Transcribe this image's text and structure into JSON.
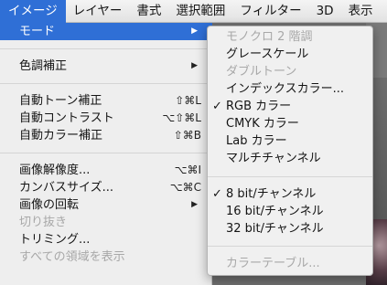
{
  "menubar": {
    "items": [
      "イメージ",
      "レイヤー",
      "書式",
      "選択範囲",
      "フィルター",
      "3D",
      "表示"
    ],
    "active_index": 0
  },
  "image_menu": {
    "items": [
      {
        "label": "モード",
        "shortcut": "",
        "submenu": true,
        "highlighted": true,
        "disabled": false
      },
      {
        "label": "色調補正",
        "shortcut": "",
        "submenu": true,
        "highlighted": false,
        "disabled": false
      },
      {
        "label": "自動トーン補正",
        "shortcut": "⇧⌘L",
        "submenu": false,
        "highlighted": false,
        "disabled": false
      },
      {
        "label": "自動コントラスト",
        "shortcut": "⌥⇧⌘L",
        "submenu": false,
        "highlighted": false,
        "disabled": false
      },
      {
        "label": "自動カラー補正",
        "shortcut": "⇧⌘B",
        "submenu": false,
        "highlighted": false,
        "disabled": false
      },
      {
        "label": "画像解像度...",
        "shortcut": "⌥⌘I",
        "submenu": false,
        "highlighted": false,
        "disabled": false
      },
      {
        "label": "カンバスサイズ...",
        "shortcut": "⌥⌘C",
        "submenu": false,
        "highlighted": false,
        "disabled": false
      },
      {
        "label": "画像の回転",
        "shortcut": "",
        "submenu": true,
        "highlighted": false,
        "disabled": false
      },
      {
        "label": "切り抜き",
        "shortcut": "",
        "submenu": false,
        "highlighted": false,
        "disabled": true
      },
      {
        "label": "トリミング...",
        "shortcut": "",
        "submenu": false,
        "highlighted": false,
        "disabled": false
      },
      {
        "label": "すべての領域を表示",
        "shortcut": "",
        "submenu": false,
        "highlighted": false,
        "disabled": true
      }
    ]
  },
  "mode_submenu": {
    "items": [
      {
        "label": "モノクロ 2 階調",
        "checked": false,
        "disabled": true
      },
      {
        "label": "グレースケール",
        "checked": false,
        "disabled": false
      },
      {
        "label": "ダブルトーン",
        "checked": false,
        "disabled": true
      },
      {
        "label": "インデックスカラー...",
        "checked": false,
        "disabled": false
      },
      {
        "label": "RGB カラー",
        "checked": true,
        "disabled": false
      },
      {
        "label": "CMYK カラー",
        "checked": false,
        "disabled": false
      },
      {
        "label": "Lab カラー",
        "checked": false,
        "disabled": false
      },
      {
        "label": "マルチチャンネル",
        "checked": false,
        "disabled": false
      },
      {
        "label": "8 bit/チャンネル",
        "checked": true,
        "disabled": false
      },
      {
        "label": "16 bit/チャンネル",
        "checked": false,
        "disabled": false
      },
      {
        "label": "32 bit/チャンネル",
        "checked": false,
        "disabled": false
      },
      {
        "label": "カラーテーブル...",
        "checked": false,
        "disabled": true
      }
    ],
    "check_glyph": "✓"
  },
  "colors": {
    "highlight": "#2f6fd6",
    "menu_bg": "#eeeeee",
    "disabled_text": "#a8a8a8"
  }
}
